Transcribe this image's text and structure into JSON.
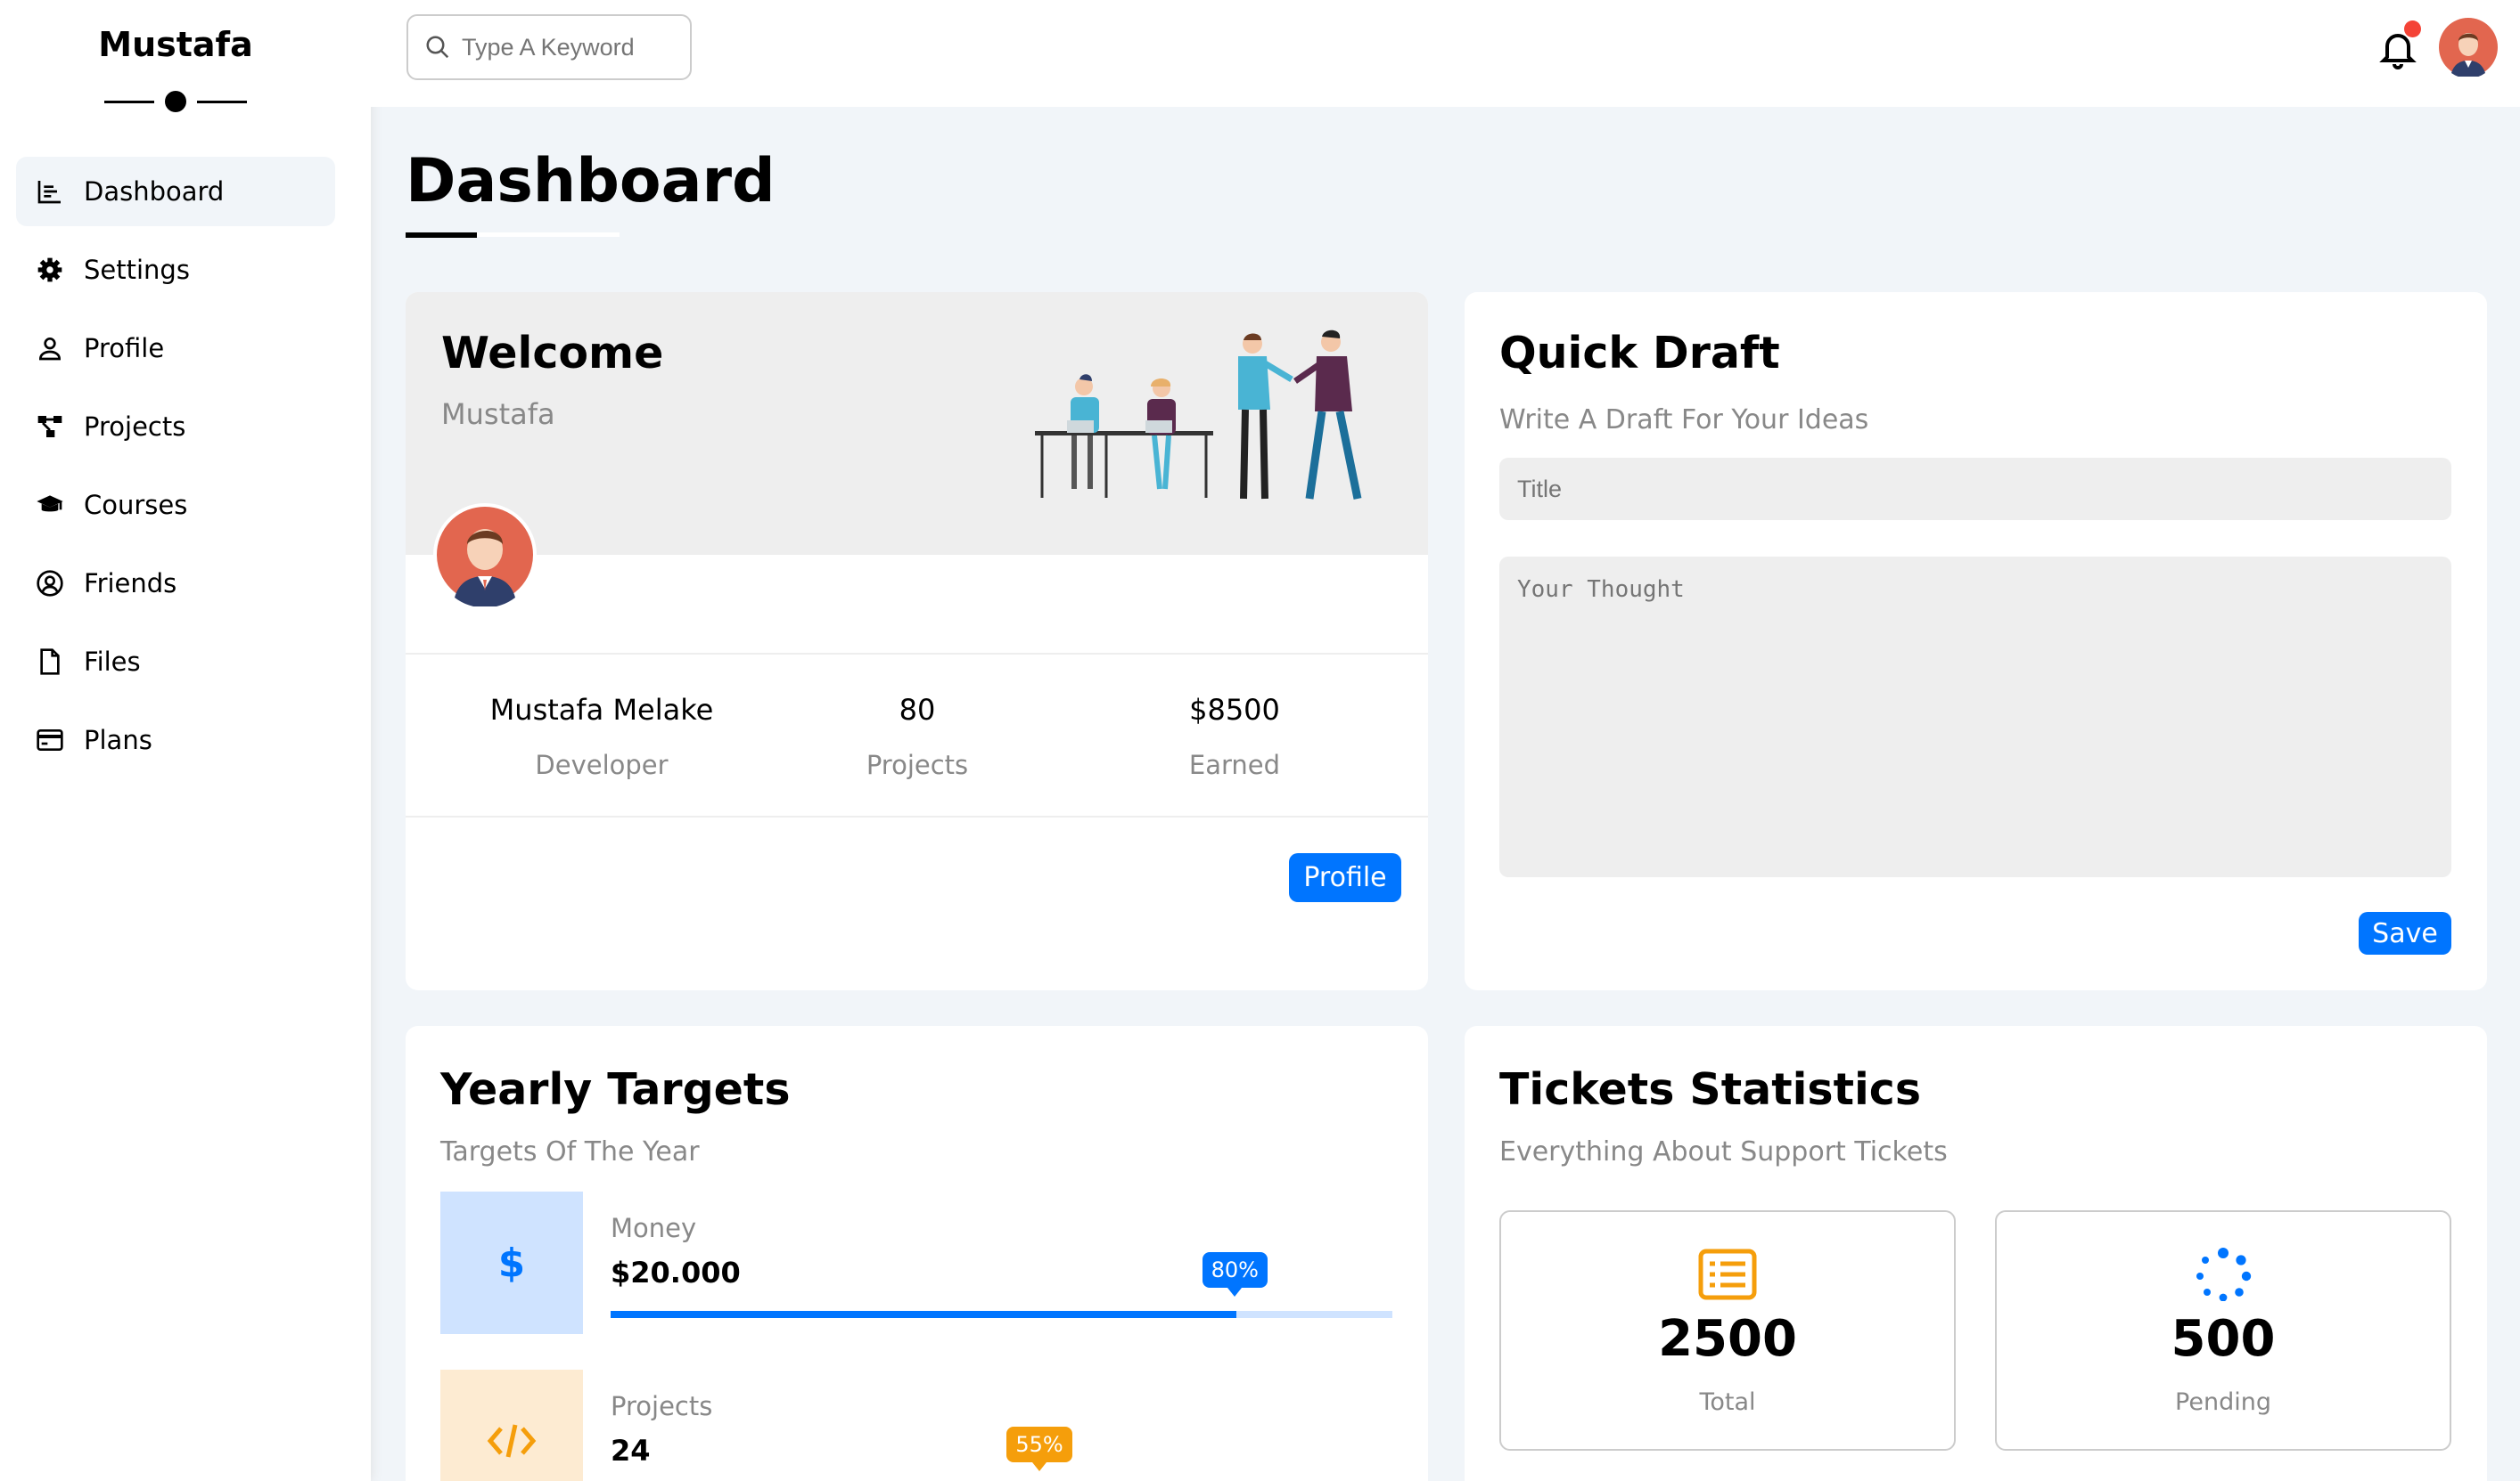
{
  "sidebar": {
    "brand": "Mustafa",
    "items": [
      {
        "label": "Dashboard",
        "icon": "chart-icon",
        "active": true
      },
      {
        "label": "Settings",
        "icon": "gear-icon"
      },
      {
        "label": "Profile",
        "icon": "user-icon"
      },
      {
        "label": "Projects",
        "icon": "diagram-icon"
      },
      {
        "label": "Courses",
        "icon": "graduation-cap-icon"
      },
      {
        "label": "Friends",
        "icon": "user-circle-icon"
      },
      {
        "label": "Files",
        "icon": "file-icon"
      },
      {
        "label": "Plans",
        "icon": "credit-card-icon"
      }
    ]
  },
  "header": {
    "search_placeholder": "Type A Keyword",
    "has_notification": true
  },
  "page": {
    "title": "Dashboard"
  },
  "welcome": {
    "title": "Welcome",
    "subtitle": "Mustafa",
    "stats": [
      {
        "value": "Mustafa Melake",
        "label": "Developer"
      },
      {
        "value": "80",
        "label": "Projects"
      },
      {
        "value": "$8500",
        "label": "Earned"
      }
    ],
    "profile_button": "Profile"
  },
  "draft": {
    "title": "Quick Draft",
    "subtitle": "Write A Draft For Your Ideas",
    "title_placeholder": "Title",
    "thought_placeholder": "Your Thought",
    "save_button": "Save"
  },
  "targets": {
    "title": "Yearly Targets",
    "subtitle": "Targets Of The Year",
    "items": [
      {
        "label": "Money",
        "value": "$20.000",
        "progress": 80,
        "badge": "80%",
        "color": "#0075ff",
        "bg": "#cfe3ff",
        "icon": "dollar-icon"
      },
      {
        "label": "Projects",
        "value": "24",
        "progress": 55,
        "badge": "55%",
        "color": "#f59e0b",
        "bg": "#fdebd2",
        "icon": "code-icon"
      }
    ]
  },
  "tickets": {
    "title": "Tickets Statistics",
    "subtitle": "Everything About Support Tickets",
    "items": [
      {
        "value": "2500",
        "label": "Total",
        "icon": "list-icon",
        "color": "#f59e0b"
      },
      {
        "value": "500",
        "label": "Pending",
        "icon": "spinner-icon",
        "color": "#0075ff"
      }
    ]
  },
  "colors": {
    "accent": "#0075ff",
    "warning": "#f59e0b",
    "notification": "#f44336"
  }
}
